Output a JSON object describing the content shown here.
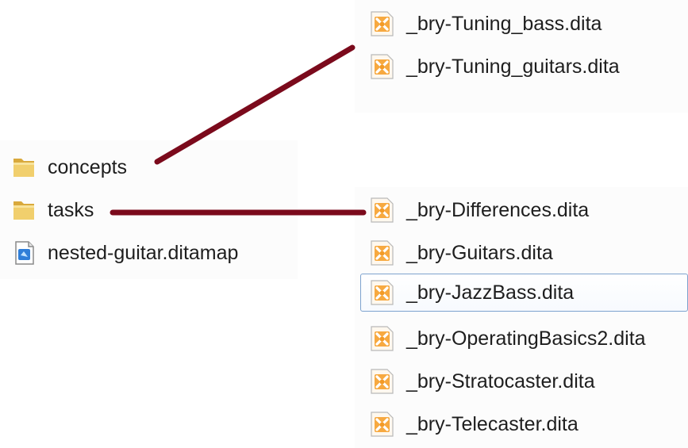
{
  "left_panel": {
    "items": [
      {
        "label": "concepts",
        "icon": "folder-icon"
      },
      {
        "label": "tasks",
        "icon": "folder-icon"
      },
      {
        "label": "nested-guitar.ditamap",
        "icon": "ditamap-file-icon"
      }
    ]
  },
  "concepts_panel": {
    "items": [
      {
        "label": "_bry-Tuning_bass.dita",
        "icon": "dita-file-icon"
      },
      {
        "label": "_bry-Tuning_guitars.dita",
        "icon": "dita-file-icon"
      }
    ]
  },
  "tasks_panel": {
    "selected_index": 2,
    "items": [
      {
        "label": "_bry-Differences.dita",
        "icon": "dita-file-icon"
      },
      {
        "label": "_bry-Guitars.dita",
        "icon": "dita-file-icon"
      },
      {
        "label": "_bry-JazzBass.dita",
        "icon": "dita-file-icon"
      },
      {
        "label": "_bry-OperatingBasics2.dita",
        "icon": "dita-file-icon"
      },
      {
        "label": "_bry-Stratocaster.dita",
        "icon": "dita-file-icon"
      },
      {
        "label": "_bry-Telecaster.dita",
        "icon": "dita-file-icon"
      }
    ]
  },
  "colors": {
    "connector_line": "#7b0a1c",
    "selection_border": "#7da2ce",
    "folder_yellow": "#e9c35a",
    "dita_orange": "#f39a26"
  }
}
